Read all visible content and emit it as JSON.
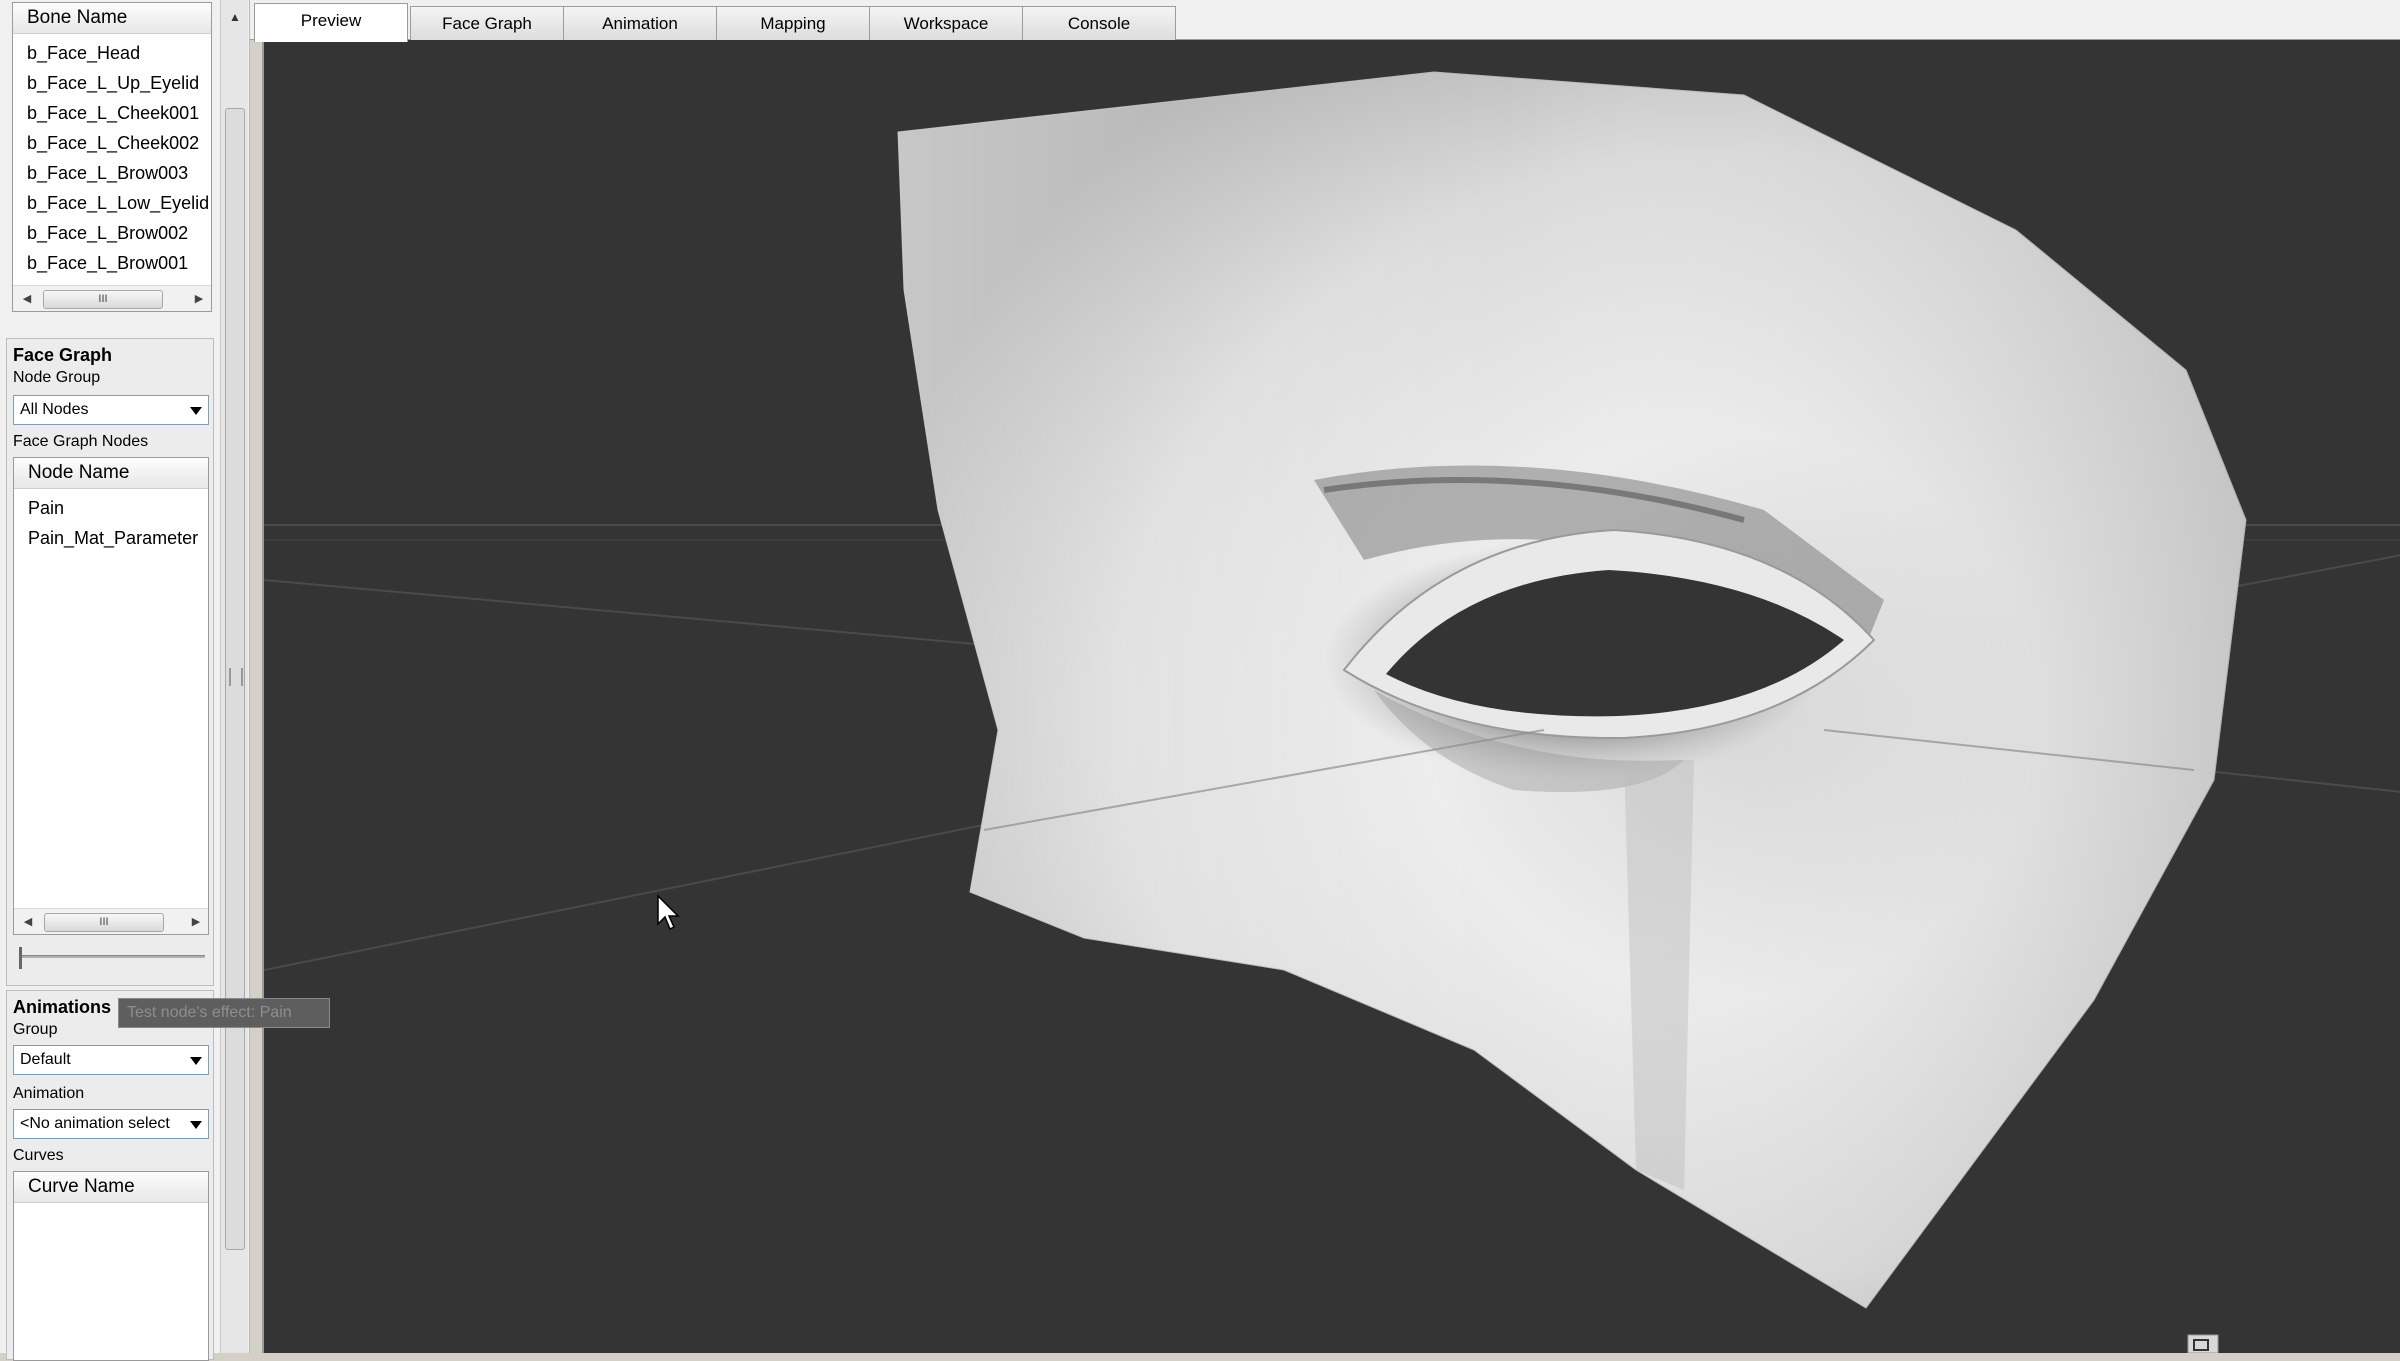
{
  "bone_list": {
    "header": "Bone Name",
    "items": [
      "b_Face_Head",
      "b_Face_L_Up_Eyelid",
      "b_Face_L_Cheek001",
      "b_Face_L_Cheek002",
      "b_Face_L_Brow003",
      "b_Face_L_Low_Eyelid",
      "b_Face_L_Brow002",
      "b_Face_L_Brow001"
    ],
    "scroll_grip": "III"
  },
  "face_graph": {
    "title": "Face Graph",
    "node_group_label": "Node Group",
    "node_group_value": "All Nodes",
    "nodes_label": "Face Graph Nodes",
    "nodes_header": "Node Name",
    "nodes": [
      "Pain",
      "Pain_Mat_Parameter"
    ],
    "scroll_grip": "III"
  },
  "animations": {
    "title": "Animations",
    "group_label": "Group",
    "group_value": "Default",
    "animation_label": "Animation",
    "animation_value": "<No animation select",
    "curves_label": "Curves",
    "curves_header": "Curve Name"
  },
  "tooltip": "Test node's effect: Pain",
  "tabs": [
    "Preview",
    "Face Graph",
    "Animation",
    "Mapping",
    "Workspace",
    "Console"
  ],
  "active_tab": "Preview",
  "colors": {
    "viewport_bg": "#343434",
    "panel_bg": "#f0f0f0",
    "mesh_light": "#e8e8e8",
    "mesh_shadow": "#6a6a6a"
  }
}
